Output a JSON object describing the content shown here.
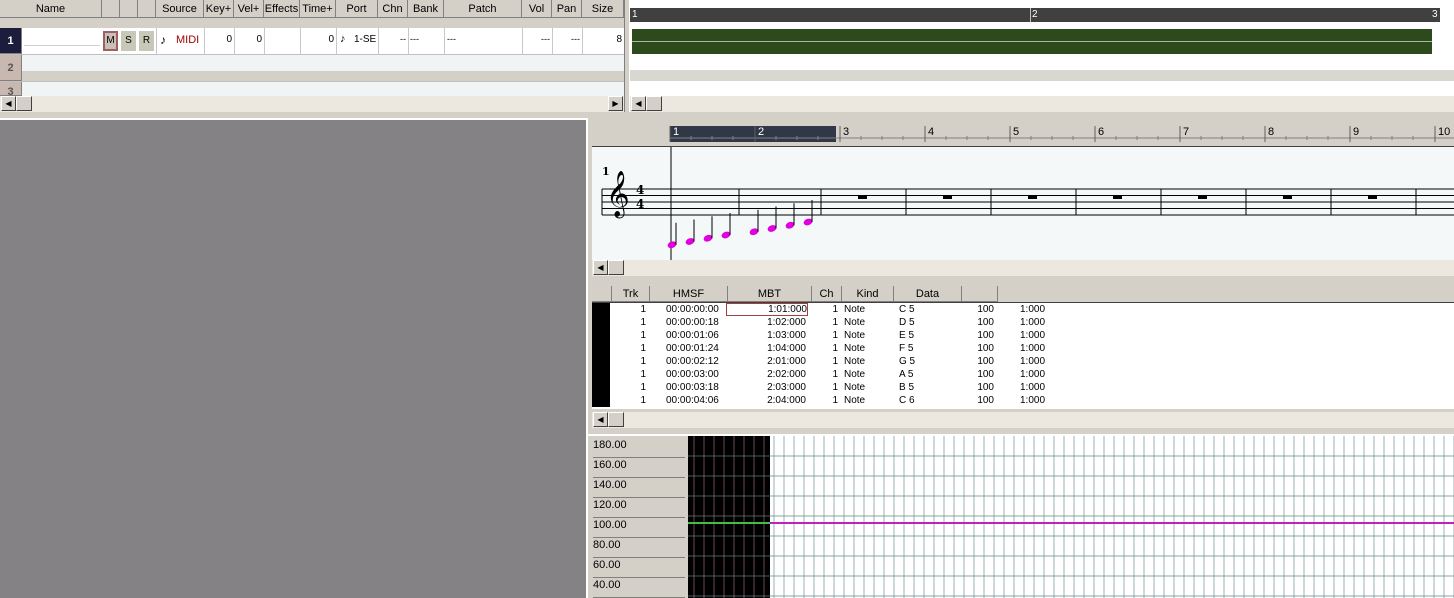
{
  "track_view": {
    "columns": [
      "Name",
      "Source",
      "Key+",
      "Vel+",
      "Effects",
      "Time+",
      "Port",
      "Chn",
      "Bank",
      "Patch",
      "Vol",
      "Pan",
      "Size"
    ],
    "msr_buttons": [
      "M",
      "S",
      "R"
    ],
    "rows": [
      {
        "num": "1",
        "source": "MIDI",
        "key": "0",
        "vel": "0",
        "time": "0",
        "port": "1-SE",
        "chn": "--",
        "bank": "---",
        "patch": "---",
        "vol": "---",
        "pan": "---",
        "size": "8"
      },
      {
        "num": "2"
      },
      {
        "num": "3"
      }
    ],
    "clip_ruler": [
      "1",
      "2",
      "3"
    ]
  },
  "staff_view": {
    "measure_ruler": [
      "1",
      "2",
      "3",
      "4",
      "5",
      "6",
      "7",
      "8",
      "9",
      "10"
    ],
    "measure_number": "1",
    "time_signature": {
      "top": "4",
      "bottom": "4"
    },
    "note_color": "#e000e0"
  },
  "event_list": {
    "columns": [
      "Trk",
      "HMSF",
      "MBT",
      "Ch",
      "Kind",
      "Data"
    ],
    "events": [
      {
        "trk": "1",
        "hmsf": "00:00:00:00",
        "mbt": "1:01:000",
        "ch": "1",
        "kind": "Note",
        "data": "C 5",
        "vel": "100",
        "dur": "1:000"
      },
      {
        "trk": "1",
        "hmsf": "00:00:00:18",
        "mbt": "1:02:000",
        "ch": "1",
        "kind": "Note",
        "data": "D 5",
        "vel": "100",
        "dur": "1:000"
      },
      {
        "trk": "1",
        "hmsf": "00:00:01:06",
        "mbt": "1:03:000",
        "ch": "1",
        "kind": "Note",
        "data": "E 5",
        "vel": "100",
        "dur": "1:000"
      },
      {
        "trk": "1",
        "hmsf": "00:00:01:24",
        "mbt": "1:04:000",
        "ch": "1",
        "kind": "Note",
        "data": "F 5",
        "vel": "100",
        "dur": "1:000"
      },
      {
        "trk": "1",
        "hmsf": "00:00:02:12",
        "mbt": "2:01:000",
        "ch": "1",
        "kind": "Note",
        "data": "G 5",
        "vel": "100",
        "dur": "1:000"
      },
      {
        "trk": "1",
        "hmsf": "00:00:03:00",
        "mbt": "2:02:000",
        "ch": "1",
        "kind": "Note",
        "data": "A 5",
        "vel": "100",
        "dur": "1:000"
      },
      {
        "trk": "1",
        "hmsf": "00:00:03:18",
        "mbt": "2:03:000",
        "ch": "1",
        "kind": "Note",
        "data": "B 5",
        "vel": "100",
        "dur": "1:000"
      },
      {
        "trk": "1",
        "hmsf": "00:00:04:06",
        "mbt": "2:04:000",
        "ch": "1",
        "kind": "Note",
        "data": "C 6",
        "vel": "100",
        "dur": "1:000"
      }
    ]
  },
  "tempo_view": {
    "y_labels": [
      "180.00",
      "160.00",
      "140.00",
      "120.00",
      "100.00",
      "80.00",
      "60.00",
      "40.00"
    ],
    "tempo_value": 100,
    "line_color_selected": "#40c040",
    "line_color": "#c020c0"
  },
  "colors": {
    "clip_fill": "#2d4a1c",
    "note_magenta": "#e000e0",
    "midi_text": "#a00000"
  }
}
